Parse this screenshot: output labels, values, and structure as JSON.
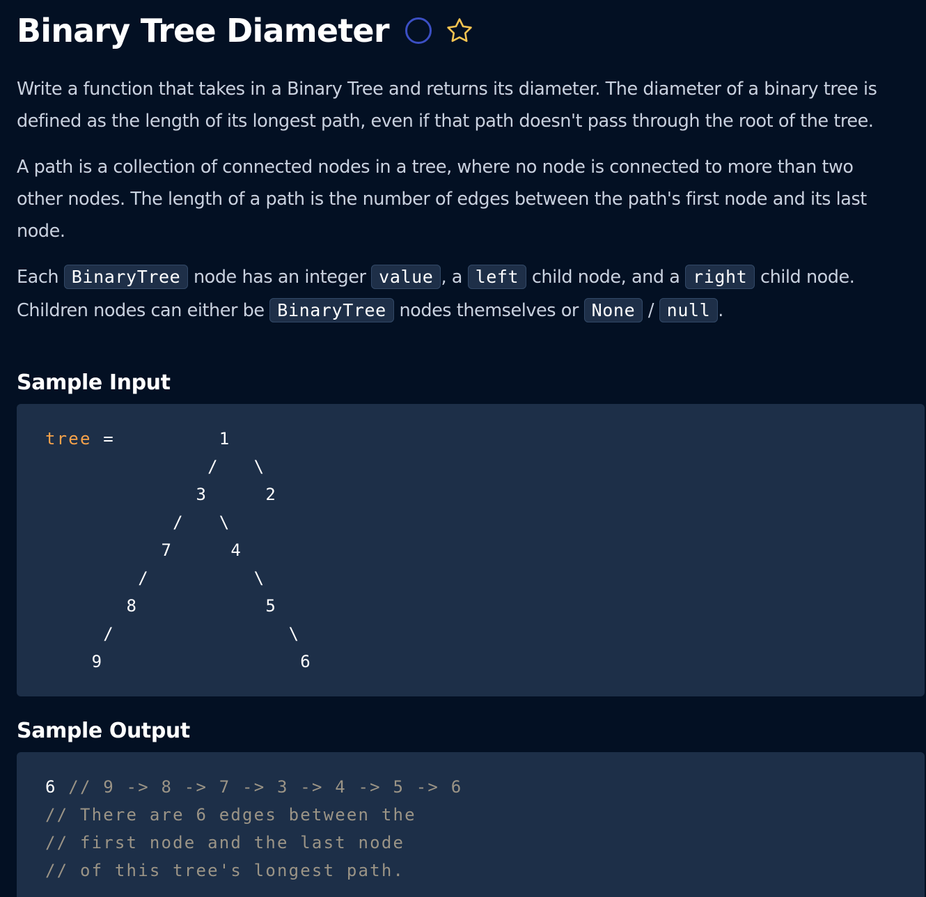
{
  "problem": {
    "title": "Binary Tree Diameter",
    "status_icon": "circle-outline-icon",
    "favorite_icon": "star-outline-icon"
  },
  "description": {
    "p1": [
      "Write a function that takes in a Binary Tree and returns its diameter. The diameter of a binary tree is",
      "defined as the length of its longest path, even if that path doesn't pass through the root of the tree."
    ],
    "p2": [
      "A path is a collection of connected nodes in a tree, where no node is connected to more than two",
      "other nodes. The length of a path is the number of edges between the path's first node and its last",
      "node."
    ],
    "p3": {
      "t1": "Each ",
      "c1": "BinaryTree",
      "t2": " node has an integer ",
      "c2": "value",
      "t3": ", a ",
      "c3": "left",
      "t4": " child node, and a ",
      "c4": "right",
      "t5": " child node.",
      "t6": "Children nodes can either be ",
      "c5": "BinaryTree",
      "t7": " nodes themselves or ",
      "c6": "None",
      "t8": " / ",
      "c7": "null",
      "t9": "."
    }
  },
  "sample_input": {
    "heading": "Sample Input",
    "var_name": "tree",
    "assign": " =         1",
    "tree_lines": [
      "              /   \\",
      "             3     2",
      "           /   \\",
      "          7     4",
      "        /         \\",
      "       8           5",
      "     /               \\",
      "    9                 6"
    ]
  },
  "sample_output": {
    "heading": "Sample Output",
    "result": "6",
    "comment_first": " // 9 -> 8 -> 7 -> 3 -> 4 -> 5 -> 6",
    "comment_lines": [
      "// There are 6 edges between the",
      "// first node and the last node",
      "// of this tree's longest path."
    ]
  },
  "colors": {
    "background": "#031023",
    "code_background": "#1d2f48",
    "accent_orange": "#f6a24a",
    "comment": "#9b9486",
    "status_blue": "#3b4fc4",
    "star_gold": "#f5c451"
  }
}
